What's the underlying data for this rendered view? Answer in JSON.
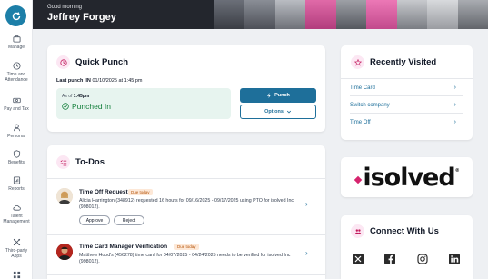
{
  "sidebar": {
    "items": [
      {
        "label": "Manage",
        "icon": "briefcase-icon"
      },
      {
        "label": "Time and Attendance",
        "icon": "clock-icon"
      },
      {
        "label": "Pay and Tax",
        "icon": "money-icon"
      },
      {
        "label": "Personal",
        "icon": "person-icon"
      },
      {
        "label": "Benefits",
        "icon": "shield-icon"
      },
      {
        "label": "Reports",
        "icon": "report-icon"
      },
      {
        "label": "Talent Management",
        "icon": "cloud-icon"
      },
      {
        "label": "Third-party Apps",
        "icon": "apps-icon"
      }
    ]
  },
  "header": {
    "greeting": "Good morning",
    "user_name": "Jeffrey Forgey"
  },
  "quick_punch": {
    "title": "Quick Punch",
    "last_punch_label": "Last punch",
    "last_punch_direction": "IN",
    "last_punch_time": "01/10/2025 at 1:45 pm",
    "as_of_label": "As of",
    "as_of_time": "1:45pm",
    "status": "Punched In",
    "punch_button": "Punch",
    "options_button": "Options"
  },
  "todos": {
    "title": "To-Dos",
    "items": [
      {
        "title": "Time Off Request",
        "badge": "Due today",
        "description": "Alicia Harrington (348912) requested 16 hours for 09/16/2025 - 09/17/2025 using PTO for isolved Inc (998012).",
        "approve": "Approve",
        "reject": "Reject"
      },
      {
        "title": "Time Card Manager Verification",
        "badge": "Due today",
        "description": "Matthew Hood's (456278) time card for 04/07/2025 - 04/24/2025 needs to be verified for isolved Inc (998012)."
      }
    ]
  },
  "recently_visited": {
    "title": "Recently Visited",
    "items": [
      "Time Card",
      "Switch company",
      "Time Off"
    ]
  },
  "brand": {
    "logo_text": "isolved",
    "accent": "#d6246e"
  },
  "connect": {
    "title": "Connect With Us",
    "networks": [
      "x-icon",
      "facebook-icon",
      "instagram-icon",
      "linkedin-icon"
    ]
  },
  "colors": {
    "primary": "#1e6f9a",
    "success": "#15803d",
    "pink": "#c2185b"
  }
}
